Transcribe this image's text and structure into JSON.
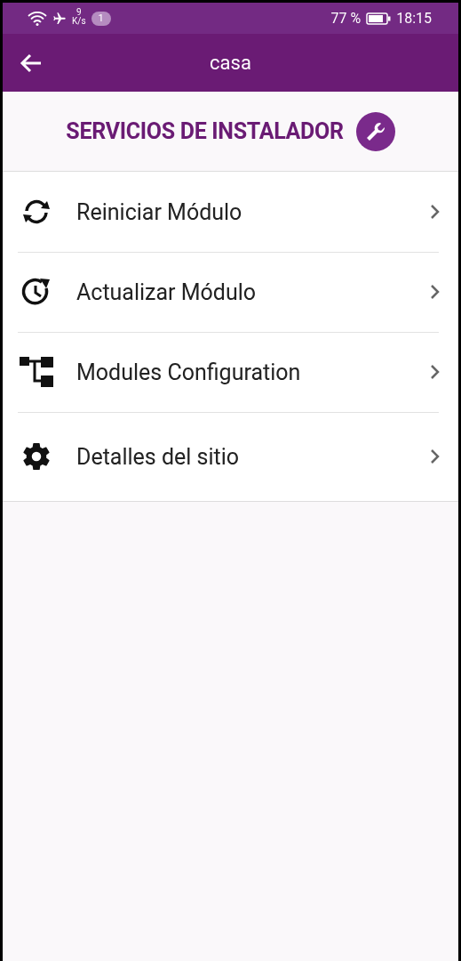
{
  "status_bar": {
    "net_speed_value": "9",
    "net_speed_unit": "K/s",
    "notification_count": "1",
    "battery_percent": "77 %",
    "time": "18:15"
  },
  "app_bar": {
    "title": "casa"
  },
  "section": {
    "title": "SERVICIOS DE INSTALADOR"
  },
  "menu": [
    {
      "kind": "restart",
      "label": "Reiniciar Módulo"
    },
    {
      "kind": "update",
      "label": "Actualizar Módulo"
    },
    {
      "kind": "tree",
      "label": "Modules Configuration"
    },
    {
      "kind": "settings",
      "label": "Detalles del sitio"
    }
  ]
}
